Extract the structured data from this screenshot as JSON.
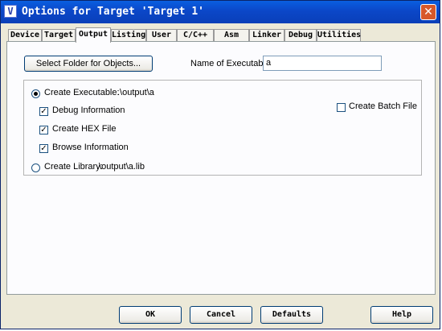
{
  "window": {
    "title": "Options for Target 'Target 1'"
  },
  "tabs": [
    {
      "label": "Device"
    },
    {
      "label": "Target"
    },
    {
      "label": "Output"
    },
    {
      "label": "Listing"
    },
    {
      "label": "User"
    },
    {
      "label": "C/C++"
    },
    {
      "label": "Asm"
    },
    {
      "label": "Linker"
    },
    {
      "label": "Debug"
    },
    {
      "label": "Utilities"
    }
  ],
  "active_tab": "Output",
  "output": {
    "select_folder_label": "Select Folder for Objects...",
    "name_label": "Name of Executable:",
    "name_value": "a",
    "create_executable": {
      "label": "Create Executable:",
      "path": ".\\output\\a",
      "selected": true
    },
    "debug_info": {
      "label": "Debug Information",
      "checked": true
    },
    "create_hex": {
      "label": "Create HEX File",
      "checked": true
    },
    "browse_info": {
      "label": "Browse Information",
      "checked": true
    },
    "create_batch": {
      "label": "Create Batch File",
      "checked": false
    },
    "create_library": {
      "label": "Create Library:",
      "path": ".\\output\\a.lib",
      "selected": false
    }
  },
  "buttons": {
    "ok": "OK",
    "cancel": "Cancel",
    "defaults": "Defaults",
    "help": "Help"
  }
}
